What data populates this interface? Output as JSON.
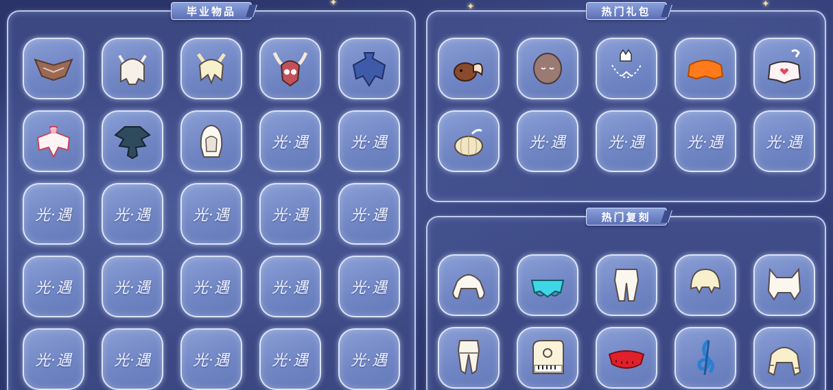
{
  "colors": {
    "background": "#2e3870",
    "panel_border": "#d7e2ff",
    "slot_fill": "#7c91cc",
    "title_tab": "#6f84c6"
  },
  "panels": {
    "graduation": {
      "title": "毕业物品"
    },
    "gift_packs": {
      "title": "热门礼包"
    },
    "reruns": {
      "title": "热门复刻"
    }
  },
  "placeholder_label": "光·遇",
  "graduation_items": [
    {
      "icon": "brown-wing-cape-icon"
    },
    {
      "icon": "white-horned-hair-icon"
    },
    {
      "icon": "cream-eared-hair-icon"
    },
    {
      "icon": "owl-mask-icon"
    },
    {
      "icon": "blue-cape-icon"
    },
    {
      "icon": "white-pink-cape-icon"
    },
    {
      "icon": "dark-layered-cape-icon"
    },
    {
      "icon": "white-hood-icon"
    },
    {
      "icon": "placeholder-logo-icon"
    },
    {
      "icon": "placeholder-logo-icon"
    },
    {
      "icon": "placeholder-logo-icon"
    },
    {
      "icon": "placeholder-logo-icon"
    },
    {
      "icon": "placeholder-logo-icon"
    },
    {
      "icon": "placeholder-logo-icon"
    },
    {
      "icon": "placeholder-logo-icon"
    },
    {
      "icon": "placeholder-logo-icon"
    },
    {
      "icon": "placeholder-logo-icon"
    },
    {
      "icon": "placeholder-logo-icon"
    },
    {
      "icon": "placeholder-logo-icon"
    },
    {
      "icon": "placeholder-logo-icon"
    },
    {
      "icon": "placeholder-logo-icon"
    },
    {
      "icon": "placeholder-logo-icon"
    },
    {
      "icon": "placeholder-logo-icon"
    },
    {
      "icon": "placeholder-logo-icon"
    },
    {
      "icon": "placeholder-logo-icon"
    }
  ],
  "gift_items": [
    {
      "icon": "fox-plush-icon"
    },
    {
      "icon": "sleepy-mask-icon"
    },
    {
      "icon": "cat-necklace-icon"
    },
    {
      "icon": "orange-cape-icon"
    },
    {
      "icon": "heart-cape-icon"
    },
    {
      "icon": "pumpkin-prop-icon"
    },
    {
      "icon": "placeholder-logo-icon"
    },
    {
      "icon": "placeholder-logo-icon"
    },
    {
      "icon": "placeholder-logo-icon"
    },
    {
      "icon": "placeholder-logo-icon"
    }
  ],
  "rerun_items": [
    {
      "icon": "white-pigtail-hair-icon"
    },
    {
      "icon": "cyan-cape-icon"
    },
    {
      "icon": "white-pants-icon"
    },
    {
      "icon": "bob-hair-icon"
    },
    {
      "icon": "cat-ear-hair-icon"
    },
    {
      "icon": "white-trousers-icon"
    },
    {
      "icon": "piano-prop-icon"
    },
    {
      "icon": "red-cape-icon"
    },
    {
      "icon": "treble-clef-icon"
    },
    {
      "icon": "braided-hair-icon"
    }
  ]
}
